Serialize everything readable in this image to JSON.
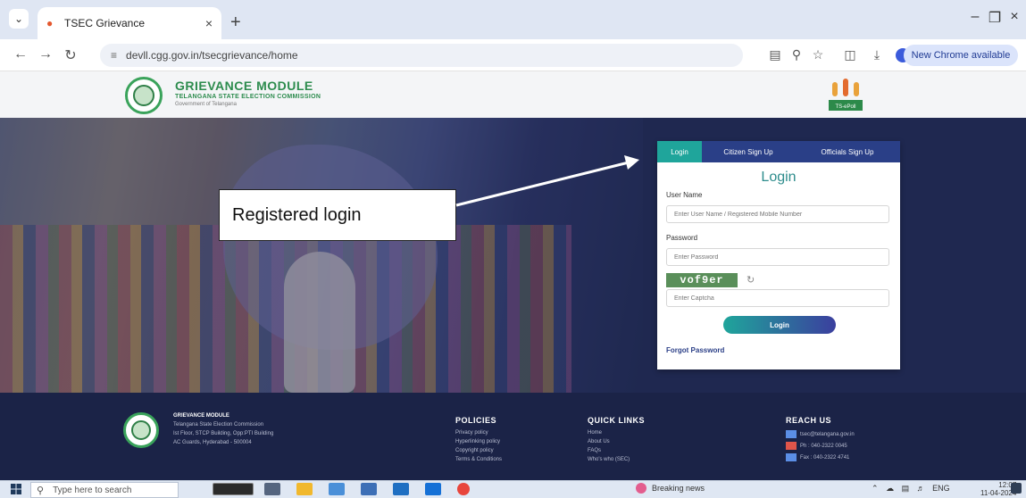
{
  "browser": {
    "tab_title": "TSEC Grievance",
    "new_tab_symbol": "+",
    "url": "devll.cgg.gov.in/tsecgrievance/home",
    "update_label": "New Chrome available"
  },
  "site": {
    "brand_title": "GRIEVANCE MODULE",
    "brand_subtitle": "TELANGANA STATE ELECTION COMMISSION",
    "brand_org": "Government of Telangana",
    "poll_logo_text": "TS-ePoll"
  },
  "annotation": {
    "callout_text": "Registered login"
  },
  "login": {
    "tabs": [
      {
        "label": "Login",
        "active": true
      },
      {
        "label": "Citizen Sign Up",
        "active": false
      },
      {
        "label": "Officials Sign Up",
        "active": false
      }
    ],
    "heading": "Login",
    "username_label": "User Name",
    "username_placeholder": "Enter User Name / Registered Mobile Number",
    "password_label": "Password",
    "password_placeholder": "Enter Password",
    "captcha_text": "vof9er",
    "captcha_placeholder": "Enter Captcha",
    "button_label": "Login",
    "forgot_label": "Forgot Password"
  },
  "footer": {
    "about_title": "GRIEVANCE MODULE",
    "about_lines": [
      "Telangana State Election Commission",
      "Ist Floor, STCP Building, Opp:PTI Building",
      "AC Guards, Hyderabad - 500004"
    ],
    "policies_title": "POLICIES",
    "policies": [
      "Privacy policy",
      "Hyperlinking policy",
      "Copyright policy",
      "Terms & Conditions"
    ],
    "quick_title": "QUICK LINKS",
    "quick_links": [
      "Home",
      "About Us",
      "FAQs",
      "Who's who (SEC)"
    ],
    "reach_title": "REACH US",
    "reach_items": [
      "tsec@telangana.gov.in",
      "Ph : 040-2322 0045",
      "Fax : 040-2322 4741"
    ]
  },
  "taskbar": {
    "search_placeholder": "Type here to search",
    "news_label": "Breaking news",
    "lang": "ENG",
    "time": "12:07",
    "date": "11-04-2024"
  },
  "colors": {
    "brand_green": "#2d8c4e",
    "nav_blue": "#2a3f87",
    "active_teal": "#1fa59b",
    "footer_bg": "#1b2347"
  }
}
